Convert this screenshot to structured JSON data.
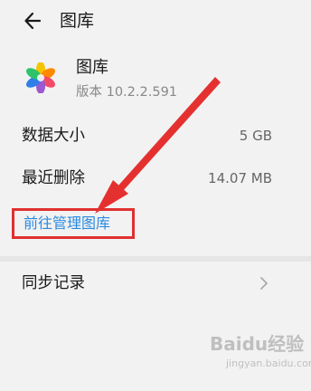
{
  "header": {
    "title": "图库",
    "back_icon": "arrow-left-icon"
  },
  "app": {
    "name": "图库",
    "version": "版本 10.2.2.591",
    "icon": "gallery-flower-icon"
  },
  "rows": [
    {
      "label": "数据大小",
      "value": "5 GB"
    },
    {
      "label": "最近删除",
      "value": "14.07 MB"
    }
  ],
  "manage_link": "前往管理图库",
  "sync": {
    "label": "同步记录",
    "icon": "chevron-right-icon"
  },
  "watermark": {
    "text": "Baidu经验",
    "sub": "jingyan.baidu.com"
  },
  "colors": {
    "link": "#2b8ae0",
    "highlight": "#e03030",
    "background": "#f2f2f2"
  }
}
